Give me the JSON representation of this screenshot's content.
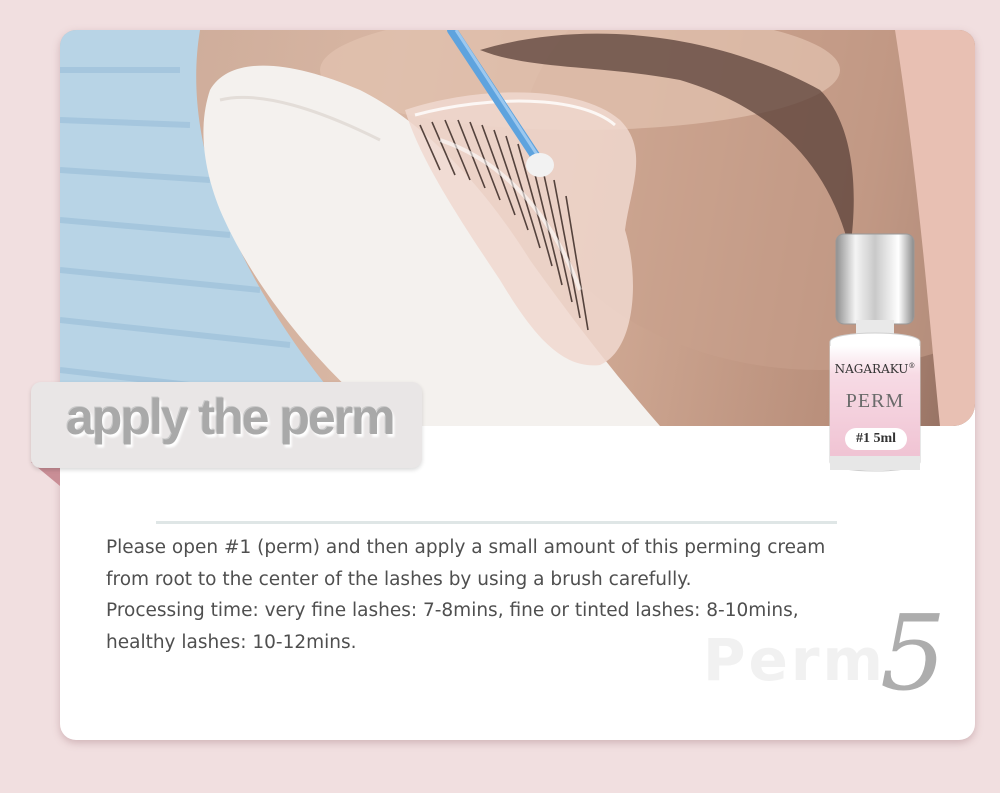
{
  "heading": "apply the perm",
  "description": [
    "Please open #1 (perm) and then apply a small amount of this perming cream from root to the center of the lashes by using a brush carefully.",
    "Processing time: very fine lashes: 7-8mins, fine or tinted lashes: 8-10mins, healthy lashes: 10-12mins."
  ],
  "step": {
    "word": "Perm",
    "number": "5"
  },
  "product": {
    "brand": "NAGARAKU",
    "trademark": "®",
    "name": "PERM",
    "volume": "#1  5ml"
  },
  "colors": {
    "background": "#f1dfe0",
    "card": "#ffffff",
    "tab": "#e9e6e6",
    "tab_fold": "#c98e96",
    "label_pink": "#f1c9d6"
  }
}
